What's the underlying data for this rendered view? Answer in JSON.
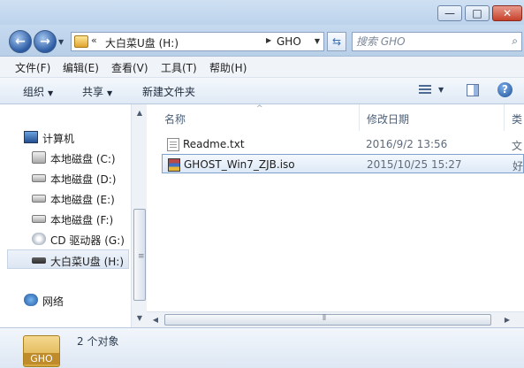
{
  "window": {
    "controls": {
      "minimize": "—",
      "maximize": "□",
      "close": "✕"
    }
  },
  "address": {
    "chevron": "«",
    "segment1": "大白菜U盘 (H:)",
    "separator": "▶",
    "segment2": "GHO",
    "dropdown": "▼"
  },
  "search": {
    "placeholder": "搜索 GHO"
  },
  "menu": [
    "文件(F)",
    "编辑(E)",
    "查看(V)",
    "工具(T)",
    "帮助(H)"
  ],
  "toolbar": {
    "organize": "组织",
    "share": "共享",
    "new_folder": "新建文件夹",
    "help": "?"
  },
  "nav": {
    "computer": "计算机",
    "drives": [
      {
        "label": "本地磁盘 (C:)",
        "icon": "system-drive-icon"
      },
      {
        "label": "本地磁盘 (D:)",
        "icon": "drive-icon"
      },
      {
        "label": "本地磁盘 (E:)",
        "icon": "drive-icon"
      },
      {
        "label": "本地磁盘 (F:)",
        "icon": "drive-icon"
      },
      {
        "label": "CD 驱动器 (G:)",
        "icon": "cd-drive-icon"
      },
      {
        "label": "大白菜U盘 (H:)",
        "icon": "usb-drive-icon",
        "selected": true
      }
    ],
    "network": "网络"
  },
  "columns": {
    "name": "名称",
    "date": "修改日期",
    "type": "类"
  },
  "files": [
    {
      "name": "Readme.txt",
      "date": "2016/9/2 13:56",
      "type": "文",
      "icon": "text-file-icon"
    },
    {
      "name": "GHOST_Win7_ZJB.iso",
      "date": "2015/10/25 15:27",
      "type": "好",
      "icon": "iso-archive-icon",
      "selected": true
    }
  ],
  "details": {
    "count": "2 个对象",
    "folder_label": "GHO"
  },
  "colors": {
    "selection_border": "#7da2ce",
    "chrome_blue": "#bcd3ec"
  }
}
